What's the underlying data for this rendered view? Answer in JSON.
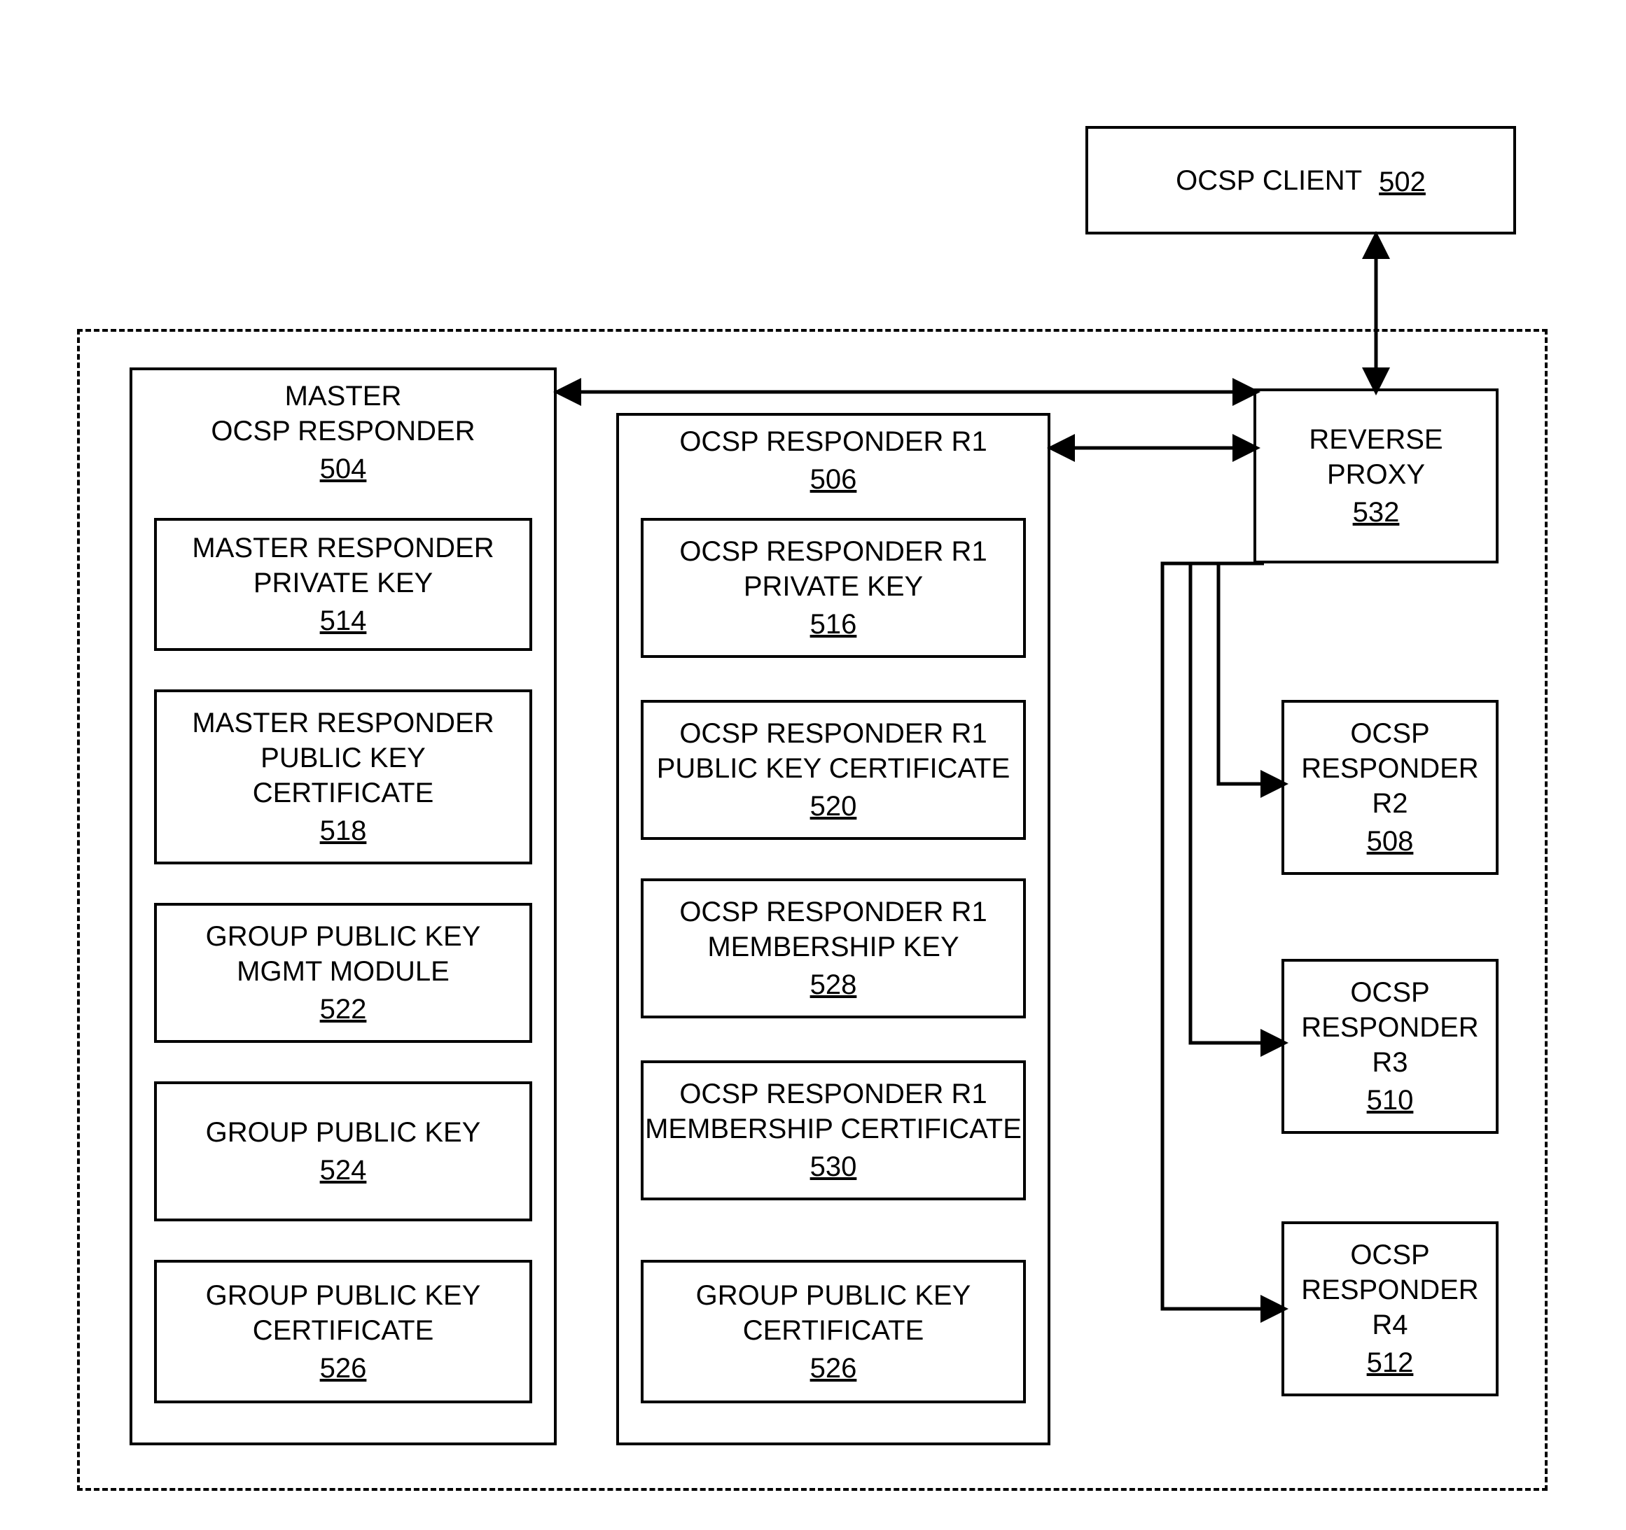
{
  "client": {
    "label": "OCSP CLIENT",
    "ref": "502"
  },
  "master": {
    "title_line1": "MASTER",
    "title_line2": "OCSP RESPONDER",
    "ref": "504",
    "items": [
      {
        "line1": "MASTER RESPONDER",
        "line2": "PRIVATE KEY",
        "ref": "514"
      },
      {
        "line1": "MASTER RESPONDER",
        "line2": "PUBLIC KEY",
        "line3": "CERTIFICATE",
        "ref": "518"
      },
      {
        "line1": "GROUP PUBLIC KEY",
        "line2": "MGMT MODULE",
        "ref": "522"
      },
      {
        "line1": "GROUP PUBLIC KEY",
        "ref": "524"
      },
      {
        "line1": "GROUP PUBLIC KEY",
        "line2": "CERTIFICATE",
        "ref": "526"
      }
    ]
  },
  "r1": {
    "title_line1": "OCSP RESPONDER R1",
    "ref": "506",
    "items": [
      {
        "line1": "OCSP RESPONDER R1",
        "line2": "PRIVATE KEY",
        "ref": "516"
      },
      {
        "line1": "OCSP RESPONDER R1",
        "line2": "PUBLIC KEY CERTIFICATE",
        "ref": "520"
      },
      {
        "line1": "OCSP RESPONDER R1",
        "line2": "MEMBERSHIP KEY",
        "ref": "528"
      },
      {
        "line1": "OCSP RESPONDER R1",
        "line2": "MEMBERSHIP CERTIFICATE",
        "ref": "530"
      },
      {
        "line1": "GROUP PUBLIC KEY",
        "line2": "CERTIFICATE",
        "ref": "526"
      }
    ]
  },
  "proxy": {
    "line1": "REVERSE",
    "line2": "PROXY",
    "ref": "532"
  },
  "r2": {
    "line1": "OCSP",
    "line2": "RESPONDER",
    "line3": "R2",
    "ref": "508"
  },
  "r3": {
    "line1": "OCSP",
    "line2": "RESPONDER",
    "line3": "R3",
    "ref": "510"
  },
  "r4": {
    "line1": "OCSP",
    "line2": "RESPONDER",
    "line3": "R4",
    "ref": "512"
  }
}
